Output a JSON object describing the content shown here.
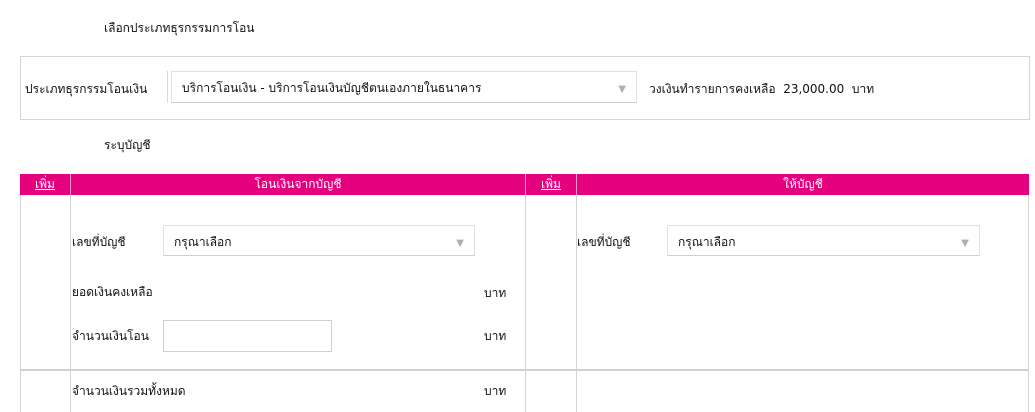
{
  "page": {
    "select_type_heading": "เลือกประเภทธุรกรรมการโอน",
    "specify_account_heading": "ระบุบัญชี"
  },
  "transaction_type": {
    "label": "ประเภทธุรกรรมโอนเงิน",
    "selected": "บริการโอนเงิน - บริการโอนเงินบัญชีตนเองภายในธนาคาร",
    "limit_text": "วงเงินทำรายการคงเหลือ",
    "limit_value": "23,000.00",
    "limit_unit": "บาท"
  },
  "from_table": {
    "add_link": "เพิ่ม",
    "header": "โอนเงินจากบัญชี",
    "account_label": "เลขที่บัญชี",
    "account_placeholder": "กรุณาเลือก",
    "balance_label": "ยอดเงินคงเหลือ",
    "amount_label": "จำนวนเงินโอน",
    "amount_value": "",
    "total_label": "จำนวนเงินรวมทั้งหมด",
    "unit": "บาท"
  },
  "to_table": {
    "add_link": "เพิ่ม",
    "header": "ให้บัญชี",
    "account_label": "เลขที่บัญชี",
    "account_placeholder": "กรุณาเลือก"
  },
  "colors": {
    "header_bg": "#e5007d",
    "border": "#d3d3d3"
  },
  "icons": {
    "dropdown": "chevron-down-icon"
  }
}
